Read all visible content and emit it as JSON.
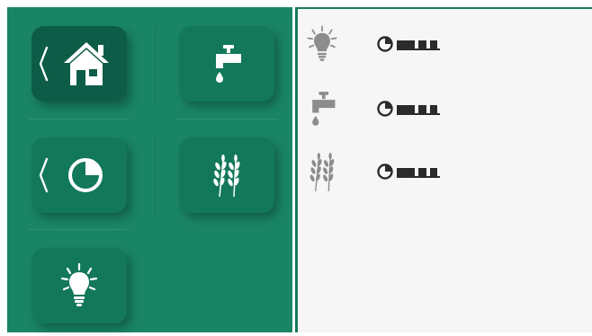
{
  "colors": {
    "panel": "#198565",
    "tile": "#13785a",
    "tile_active": "#0d5c47",
    "right_bg": "#f6f6f6",
    "status_icon": "#8c8c8c",
    "status_glyph": "#2b2b2b"
  },
  "nav": {
    "tiles": [
      {
        "id": "home",
        "icon": "home-icon",
        "active": true,
        "has_back": true
      },
      {
        "id": "water",
        "icon": "faucet-icon",
        "active": false,
        "has_back": false
      },
      {
        "id": "schedule",
        "icon": "pie-clock-icon",
        "active": false,
        "has_back": true
      },
      {
        "id": "crops",
        "icon": "wheat-icon",
        "active": false,
        "has_back": false
      },
      {
        "id": "light",
        "icon": "bulb-icon",
        "active": false,
        "has_back": false
      }
    ]
  },
  "status": {
    "rows": [
      {
        "icon": "bulb-icon"
      },
      {
        "icon": "faucet-icon"
      },
      {
        "icon": "wheat-icon"
      }
    ]
  }
}
